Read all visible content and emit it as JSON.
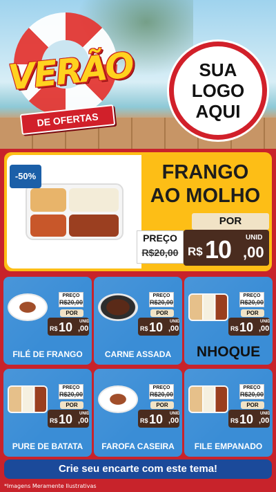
{
  "header": {
    "title": "VERÃO",
    "subtitle": "DE OFERTAS",
    "logo_lines": [
      "SUA",
      "LOGO",
      "AQUI"
    ]
  },
  "featured": {
    "discount": "-50%",
    "name_lines": [
      "FRANGO",
      "AO MOLHO"
    ],
    "preco_label": "PREÇO",
    "old_price": "R$20,00",
    "por_label": "POR",
    "currency": "R$",
    "price_int": "10",
    "price_cents": ",00",
    "unit": "UNID",
    "image_icon": "food-tray-icon"
  },
  "products": [
    {
      "name": "FILÉ DE FRANGO",
      "preco_label": "PREÇO",
      "old_price": "R$20,00",
      "por_label": "POR",
      "currency": "R$",
      "price_int": "10",
      "price_cents": ",00",
      "unit": "UNID",
      "icon": "plate-icon"
    },
    {
      "name": "CARNE ASSADA",
      "preco_label": "PREÇO",
      "old_price": "R$20,00",
      "por_label": "POR",
      "currency": "R$",
      "price_int": "10",
      "price_cents": ",00",
      "unit": "UNID",
      "icon": "bowl-icon"
    },
    {
      "name": "NHOQUE",
      "preco_label": "PREÇO",
      "old_price": "R$20,00",
      "por_label": "POR",
      "currency": "R$",
      "price_int": "10",
      "price_cents": ",00",
      "unit": "UNID",
      "icon": "tray-icon"
    },
    {
      "name": "PURE DE BATATA",
      "preco_label": "PREÇO",
      "old_price": "R$20,00",
      "por_label": "POR",
      "currency": "R$",
      "price_int": "10",
      "price_cents": ",00",
      "unit": "UNID",
      "icon": "tray-icon"
    },
    {
      "name": "FAROFA CASEIRA",
      "preco_label": "PREÇO",
      "old_price": "R$20,00",
      "por_label": "POR",
      "currency": "R$",
      "price_int": "10",
      "price_cents": ",00",
      "unit": "UNID",
      "icon": "plate-icon"
    },
    {
      "name": "FILE EMPANADO",
      "preco_label": "PREÇO",
      "old_price": "R$20,00",
      "por_label": "POR",
      "currency": "R$",
      "price_int": "10",
      "price_cents": ",00",
      "unit": "UNID",
      "icon": "tray-icon"
    }
  ],
  "cta": {
    "label": "Crie seu encarte com este tema!"
  },
  "disclaimer": "*Imagens Meramente Ilustrativas",
  "colors": {
    "background": "#c8232b",
    "featured_bg": "#fdbe16",
    "card_bg": "#3a8dd6",
    "price_bg": "#4a2c1f",
    "cta_bg": "#1b4a9a"
  }
}
